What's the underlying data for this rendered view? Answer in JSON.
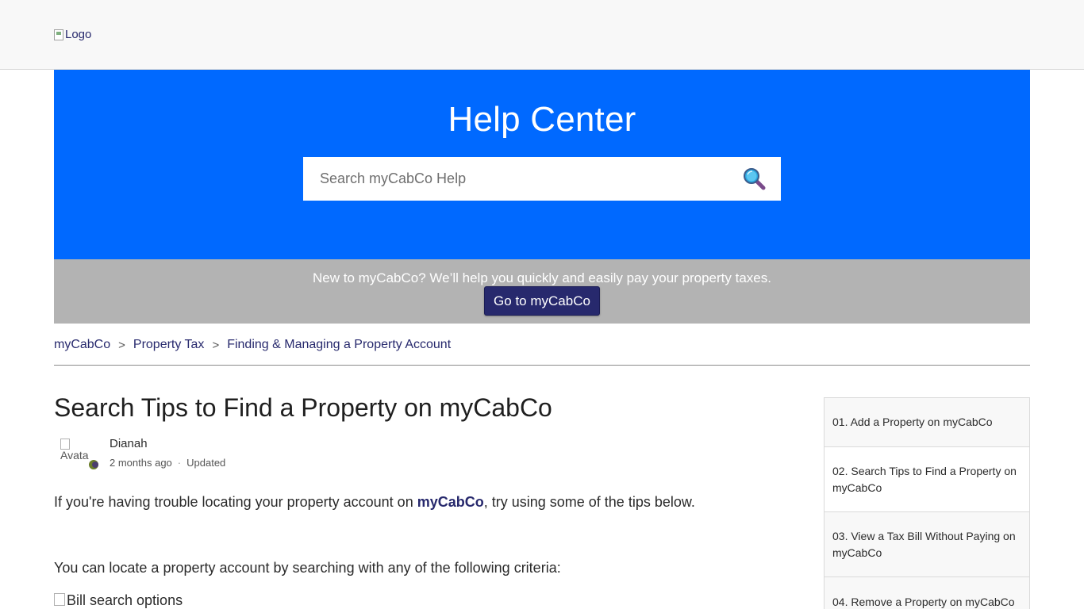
{
  "header": {
    "logo_alt": "Logo"
  },
  "hero": {
    "title": "Help Center",
    "search_placeholder": "Search myCabCo Help",
    "search_icon": "magnifier-icon"
  },
  "banner": {
    "text": "New to myCabCo? We’ll help you quickly and easily pay your property taxes.",
    "button_label": "Go to myCabCo"
  },
  "breadcrumb": {
    "items": [
      "myCabCo",
      "Property Tax",
      "Finding & Managing a Property Account"
    ],
    "separator": ">"
  },
  "article": {
    "title": "Search Tips to Find a Property on myCabCo",
    "avatar_alt": "Avata",
    "author": "Dianah",
    "time_ago": "2 months ago",
    "meta_dot": "·",
    "updated_label": "Updated",
    "para1_before": "If you're having trouble locating your property account on ",
    "para1_link": "myCabCo",
    "para1_after": ", try using some of the tips below.",
    "para2": "You can locate a property account by searching with any of the following criteria:",
    "image_alt": "Bill search options"
  },
  "sidebar": {
    "items": [
      {
        "label": "01. Add a Property on myCabCo"
      },
      {
        "label": "02. Search Tips to Find a Property on myCabCo"
      },
      {
        "label": "03. View a Tax Bill Without Paying on myCabCo"
      },
      {
        "label": "04. Remove a Property on myCabCo"
      }
    ]
  },
  "colors": {
    "hero_blue": "#0069ff",
    "banner_gray": "#b3b3b3",
    "brand_navy": "#27296d"
  }
}
